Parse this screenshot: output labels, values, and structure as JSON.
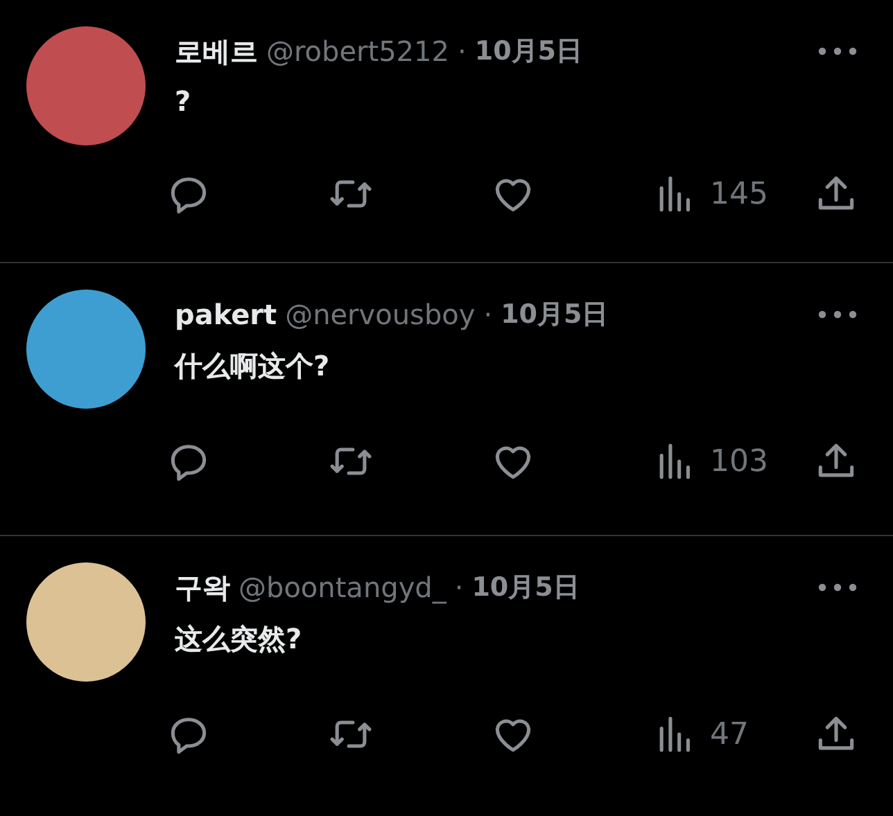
{
  "replies": [
    {
      "name": "로베르",
      "handle": "@robert5212",
      "separator": "·",
      "date": "10月5日",
      "text": "?",
      "color": "#c04d4f",
      "views": "145"
    },
    {
      "name": "pakert",
      "handle": "@nervousboy",
      "separator": "·",
      "date": "10月5日",
      "text": "什么啊这个?",
      "color": "#3e9ed1",
      "views": "103"
    },
    {
      "name": "구왁",
      "handle": "@boontangyd_",
      "separator": "·",
      "date": "10月5日",
      "text": "这么突然?",
      "color": "#dcc195",
      "views": "47"
    }
  ]
}
